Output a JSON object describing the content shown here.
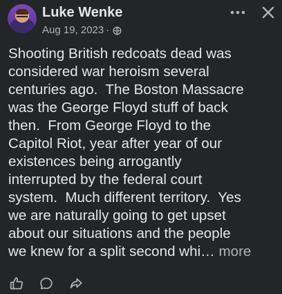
{
  "post": {
    "author": "Luke Wenke",
    "date": "Aug 19, 2023",
    "separator": "·",
    "audience_icon": "globe-icon",
    "text_lines": [
      "Shooting British redcoats dead was",
      "considered war heroism several",
      "centuries ago.  The Boston Massacre",
      "was the George Floyd stuff of back",
      "then.  From George Floyd to the",
      "Capitol Riot, year after year of our",
      "existences being arrogantly",
      "interrupted by the federal court",
      "system.  Much different territory.  Yes",
      "we are naturally going to get upset",
      "about our situations and the people",
      "we knew for a split second whi… "
    ],
    "see_more_label": "more"
  },
  "header_actions": {
    "more_icon": "more-horizontal-icon",
    "close_icon": "close-icon"
  },
  "footer_actions": {
    "like_icon": "like-icon",
    "comment_icon": "comment-icon",
    "share_icon": "share-icon"
  },
  "colors": {
    "background": "#242526",
    "primary_text": "#e4e6eb",
    "secondary_text": "#b0b3b8"
  }
}
